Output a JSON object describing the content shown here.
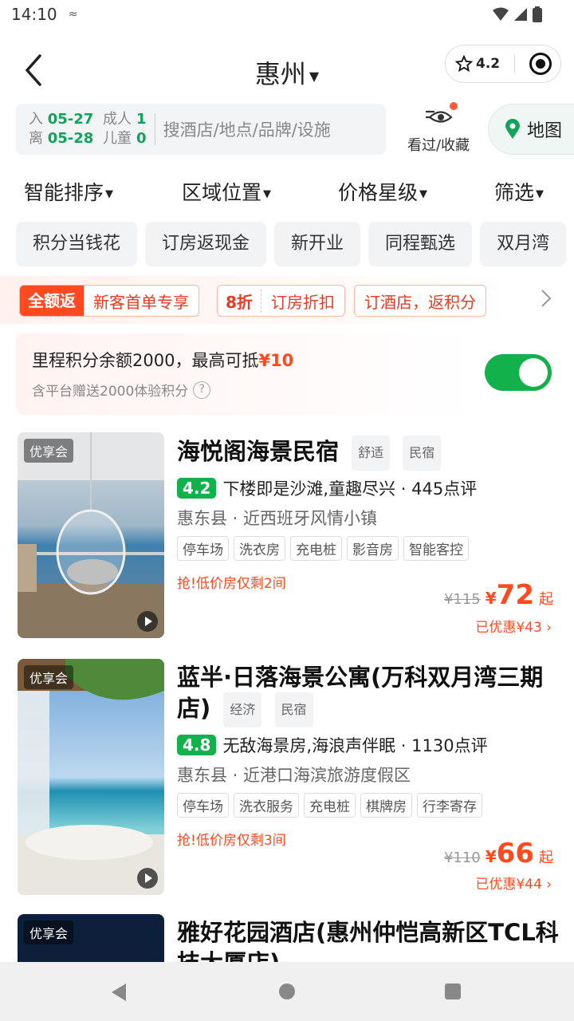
{
  "status": {
    "time": "14:10",
    "extra": "≈"
  },
  "header": {
    "city": "惠州",
    "rating": "4.2"
  },
  "search": {
    "checkin_label": "入",
    "checkin_date": "05-27",
    "adults_label": "成人",
    "adults": "1",
    "checkout_label": "离",
    "checkout_date": "05-28",
    "children_label": "儿童",
    "children": "0",
    "placeholder": "搜酒店/地点/品牌/设施",
    "history_label": "看过/收藏",
    "map_label": "地图"
  },
  "sort": [
    "智能排序",
    "区域位置",
    "价格星级",
    "筛选"
  ],
  "chips": [
    "积分当钱花",
    "订房返现金",
    "新开业",
    "同程甄选",
    "双月湾"
  ],
  "promos": {
    "p1_solid": "全额返",
    "p1_text": "新客首单专享",
    "p2_bold": "8折",
    "p2_text": "订房折扣",
    "p3_text": "订酒店，返积分"
  },
  "points": {
    "line1": "里程积分余额2000，最高可抵",
    "line1_amount": "¥10",
    "line2": "含平台赠送2000体验积分"
  },
  "hotels": [
    {
      "badge": "优享会",
      "name": "海悦阁海景民宿",
      "tags": [
        "舒适",
        "民宿"
      ],
      "score": "4.2",
      "review": "下楼即是沙滩,童趣尽兴 · 445点评",
      "location": "惠东县 · 近西班牙风情小镇",
      "amenities": [
        "停车场",
        "洗衣房",
        "充电桩",
        "影音房",
        "智能客控"
      ],
      "urgent": "抢!低价房仅剩2间",
      "orig_price": "¥115",
      "currency": "¥",
      "price": "72",
      "qi": "起",
      "discount": "已优惠¥43"
    },
    {
      "badge": "优享会",
      "name": "蓝半·日落海景公寓(万科双月湾三期店)",
      "tags": [
        "经济",
        "民宿"
      ],
      "score": "4.8",
      "review": "无敌海景房,海浪声伴眠 · 1130点评",
      "location": "惠东县 · 近港口海滨旅游度假区",
      "amenities": [
        "停车场",
        "洗衣服务",
        "充电桩",
        "棋牌房",
        "行李寄存"
      ],
      "urgent": "抢!低价房仅剩3间",
      "orig_price": "¥110",
      "currency": "¥",
      "price": "66",
      "qi": "起",
      "discount": "已优惠¥44"
    },
    {
      "badge": "优享会",
      "name": "雅好花园酒店(惠州仲恺高新区TCL科技大厦店)"
    }
  ]
}
